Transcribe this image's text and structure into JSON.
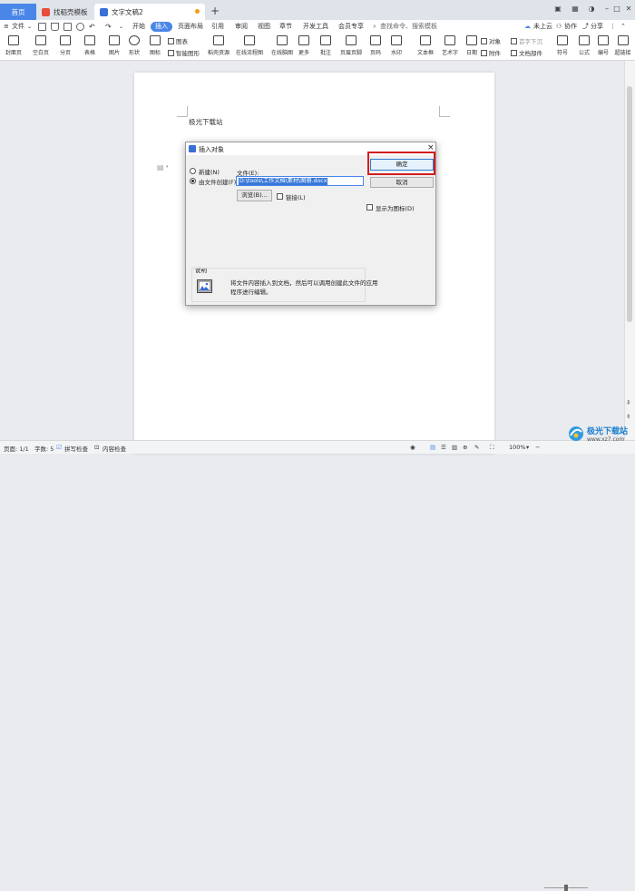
{
  "tabs": [
    {
      "label": "首页",
      "active": false,
      "kind": "home"
    },
    {
      "label": "找稻壳模板",
      "active": false
    },
    {
      "label": "文字文稿2",
      "active": true
    }
  ],
  "menu": {
    "file_label": "文件",
    "items": [
      "开始",
      "插入",
      "页面布局",
      "引用",
      "审阅",
      "视图",
      "章节",
      "开发工具",
      "会员专享"
    ],
    "active_item": "插入",
    "search_placeholder": "查找命令、搜索模板",
    "cloud_label": "未上云",
    "collab_label": "协作",
    "share_label": "分享"
  },
  "ribbon": {
    "big_buttons": [
      "封面页",
      "空白页",
      "分页",
      "表格",
      "图片",
      "形状",
      "图标",
      "稻壳资源",
      "在线流程图",
      "在线脑图",
      "更多",
      "批注",
      "页眉页脚",
      "页码",
      "水印",
      "文本框",
      "艺术字",
      "日期",
      "公式",
      "编号",
      "超链接"
    ],
    "small_items": [
      "图表",
      "智能图形",
      "对象",
      "首字下沉",
      "附件",
      "文档部件",
      "符号"
    ]
  },
  "document": {
    "text": "极光下载站"
  },
  "dialog": {
    "title": "插入对象",
    "option_new": "新建(N)",
    "option_from_file": "由文件创建(F)",
    "selected_option": "from_file",
    "file_label": "文件(E):",
    "file_path": "D:\\tools\\工作文档\\素材\\图册.docx",
    "browse_label": "浏览(B)...",
    "link_label": "链接(L)",
    "link_checked": false,
    "display_icon_label": "显示为图标(D)",
    "display_icon_checked": false,
    "ok_label": "确定",
    "cancel_label": "取消",
    "desc_title": "说明",
    "desc_line1": "将文件内容插入到文档，然后可以调用创建此文件的应用",
    "desc_line2": "程序进行编辑。"
  },
  "status": {
    "page": "页面: 1/1",
    "words": "字数: 5",
    "spell": "拼写检查",
    "content_check": "内容检查",
    "zoom": "100%"
  },
  "watermark": {
    "brand": "极光下载站",
    "url": "www.xz7.com"
  },
  "colors": {
    "accent": "#4a86e8",
    "highlight_box": "#d31d1d"
  }
}
